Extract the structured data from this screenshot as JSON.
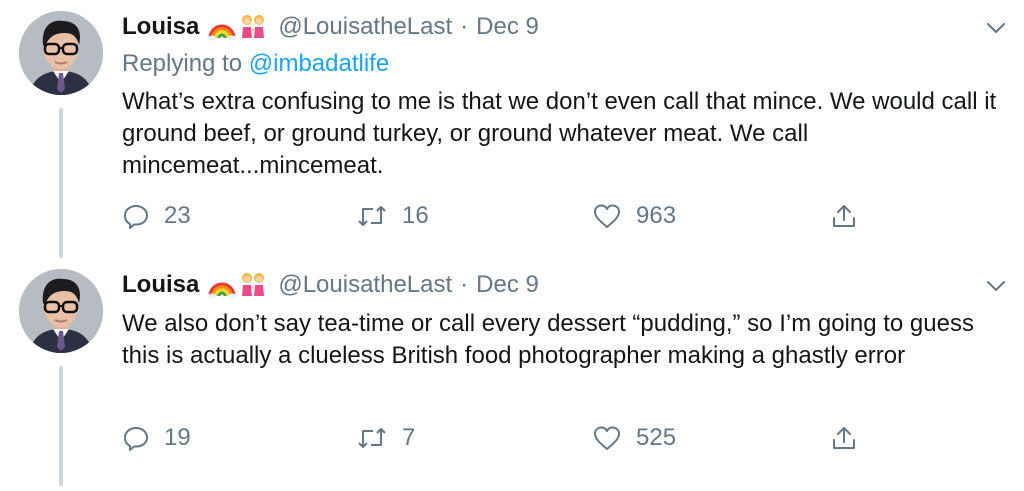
{
  "tweets": [
    {
      "name": "Louisa",
      "emoji": [
        "rainbow-emoji",
        "two-women-emoji"
      ],
      "handle": "@LouisatheLast",
      "separator": "·",
      "date": "Dec 9",
      "replying_prefix": "Replying to",
      "replying_to": "@imbadatlife",
      "text": "What’s extra confusing to me is that we don’t even call that mince. We would call it ground beef, or ground turkey, or ground whatever meat. We call mincemeat...mincemeat.",
      "replies": "23",
      "retweets": "16",
      "likes": "963"
    },
    {
      "name": "Louisa",
      "emoji": [
        "rainbow-emoji",
        "two-women-emoji"
      ],
      "handle": "@LouisatheLast",
      "separator": "·",
      "date": "Dec 9",
      "text": "We also don’t say tea-time or call every dessert “pudding,” so I’m going to guess this is actually a clueless British food photographer making a ghastly error",
      "replies": "19",
      "retweets": "7",
      "likes": "525"
    }
  ],
  "colors": {
    "text": "#14171a",
    "secondary": "#657786",
    "link": "#1da1f2",
    "thread_line": "#ccd6dd"
  }
}
